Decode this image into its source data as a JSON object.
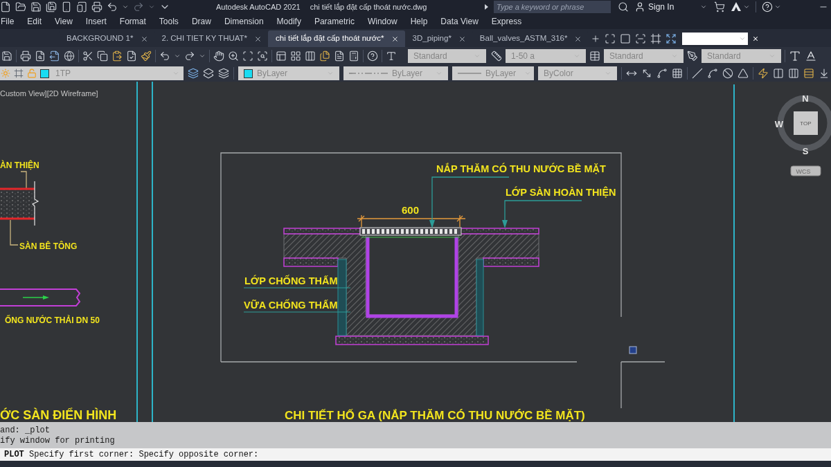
{
  "title_bar": {
    "app_title": "Autodesk AutoCAD 2021",
    "file_name": "chi tiết lắp đặt cấp thoát nước.dwg",
    "search": {
      "placeholder": "Type a keyword or phrase"
    },
    "sign_in": "Sign In"
  },
  "menu_bar": [
    "File",
    "Edit",
    "View",
    "Insert",
    "Format",
    "Tools",
    "Draw",
    "Dimension",
    "Modify",
    "Parametric",
    "Window",
    "Help",
    "Data View",
    "Express"
  ],
  "file_tabs": [
    {
      "label": "BACKGROUND 1*",
      "selected": false
    },
    {
      "label": "2. CHI TIET KY THUAT*",
      "selected": false
    },
    {
      "label": "chi tiết lắp đặt cấp thoát nước*",
      "selected": true
    },
    {
      "label": "3D_piping*",
      "selected": false
    },
    {
      "label": "Ball_valves_ASTM_316*",
      "selected": false
    }
  ],
  "styles_toolbar": {
    "text_style": "Standard",
    "dimension_style": "1-50 a",
    "table_style": "Standard",
    "multileader_style": "Standard"
  },
  "properties_toolbar": {
    "layer": "1TP",
    "paint_setting": "ByLayer",
    "linetype": "ByLayer",
    "lineweight": "ByLayer",
    "plot_style": "ByColor"
  },
  "viewport": {
    "label": "Custom View][2D Wireframe]",
    "view_cube": {
      "north": "N",
      "west": "W",
      "south": "S",
      "face": "TOP",
      "coordinate_system": "WCS"
    }
  },
  "drawing": {
    "floor_detail": {
      "finish_label": "ÀN THIỆN",
      "slab_label": "SÀN BÊ TÔNG",
      "pipe_label": "ỐNG NƯỚC THẢI DN 50",
      "title": "ỚC SÀN ĐIỂN HÌNH"
    },
    "manhole_detail": {
      "cover_label": "NẮP THĂM CÓ THU NƯỚC BỀ MẶT",
      "finish_label": "LỚP SÀN HOÀN THIỆN",
      "width_dimension": "600",
      "waterproof_layer_label": "LỚP CHỐNG THẤM",
      "waterproof_mortar_label": "VỮA CHỐNG THẤM",
      "title": "CHI TIẾT HỐ GA (NẮP THĂM CÓ THU NƯỚC BỀ MẶT)"
    }
  },
  "command_line": {
    "history": [
      "and: _plot",
      "ify window for printing"
    ],
    "prompt": "**PLOT** Specify first corner: Specify opposite corner:"
  }
}
